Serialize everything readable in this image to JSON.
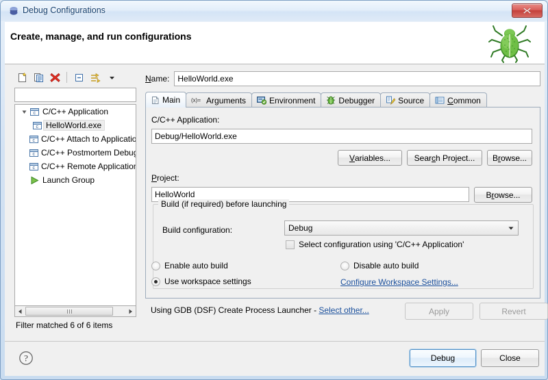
{
  "window": {
    "title": "Debug Configurations",
    "title_icon": "debug-perspective-icon",
    "close_icon": "close-icon"
  },
  "header": {
    "title": "Create, manage, and run configurations",
    "decoration_icon": "green-bug-icon"
  },
  "tree_toolbar": {
    "buttons": [
      {
        "name": "new-launch-configuration-button",
        "icon": "new-document-icon"
      },
      {
        "name": "duplicate-launch-configuration-button",
        "icon": "copy-document-icon"
      },
      {
        "name": "delete-launch-configuration-button",
        "icon": "red-x-delete-icon"
      },
      {
        "name": "collapse-all-button",
        "icon": "collapse-all-icon"
      },
      {
        "name": "filter-launch-configurations-button",
        "icon": "filter-icon"
      },
      {
        "name": "view-menu-button",
        "icon": "chevron-down-icon"
      }
    ]
  },
  "filter": {
    "value": "",
    "placeholder": "",
    "status": "Filter matched 6 of 6 items"
  },
  "tree": {
    "items": [
      {
        "label": "C/C++ Application",
        "icon": "c-application-icon",
        "indent": 0,
        "expanded": true,
        "selected": false
      },
      {
        "label": "HelloWorld.exe",
        "icon": "c-application-icon",
        "indent": 1,
        "expanded": null,
        "selected": true
      },
      {
        "label": "C/C++ Attach to Application",
        "icon": "c-application-icon",
        "indent": 0,
        "expanded": null,
        "selected": false
      },
      {
        "label": "C/C++ Postmortem Debugger",
        "icon": "c-application-icon",
        "indent": 0,
        "expanded": null,
        "selected": false
      },
      {
        "label": "C/C++ Remote Application",
        "icon": "c-application-icon",
        "indent": 0,
        "expanded": null,
        "selected": false
      },
      {
        "label": "Launch Group",
        "icon": "green-play-icon",
        "indent": 0,
        "expanded": null,
        "selected": false
      }
    ]
  },
  "name_field": {
    "label": "Name:",
    "mnemonic": "N",
    "value": "HelloWorld.exe"
  },
  "tabs": [
    {
      "label": "Main",
      "icon": "document-icon",
      "active": true
    },
    {
      "label": "Arguments",
      "icon": "variables-xy-icon",
      "active": false
    },
    {
      "label": "Environment",
      "icon": "environment-icon",
      "active": false
    },
    {
      "label": "Debugger",
      "icon": "bug-gear-icon",
      "active": false
    },
    {
      "label": "Source",
      "icon": "source-lookup-icon",
      "active": false
    },
    {
      "label": "Common",
      "icon": "common-list-icon",
      "active": false
    }
  ],
  "main_tab": {
    "application_label": "C/C++ Application:",
    "application_value": "Debug/HelloWorld.exe",
    "variables_button": "Variables...",
    "search_project_button": "Search Project...",
    "browse_app_button": "Browse...",
    "project_label": "Project:",
    "project_value": "HelloWorld",
    "browse_project_button": "Browse...",
    "build_group_title": "Build (if required) before launching",
    "build_config_label": "Build configuration:",
    "build_config_value": "Debug",
    "build_config_arrow": "chevron-down-icon",
    "select_config_checkbox_label": "Select configuration using 'C/C++ Application'",
    "select_config_checked": false,
    "radio_enable_auto_build": "Enable auto build",
    "radio_disable_auto_build": "Disable auto build",
    "radio_use_workspace_settings": "Use workspace settings",
    "selected_radio": "Use workspace settings",
    "configure_workspace_link": "Configure Workspace Settings..."
  },
  "launcher": {
    "text": "Using GDB (DSF) Create Process Launcher - ",
    "link": "Select other..."
  },
  "action_buttons": {
    "apply": "Apply",
    "apply_enabled": false,
    "revert": "Revert",
    "revert_enabled": false,
    "debug": "Debug",
    "close": "Close",
    "help_icon": "help-question-icon"
  },
  "colors": {
    "title_text": "#16406e",
    "link": "#1a4f9c",
    "close_button": "#c3403c",
    "default_button_border": "#4d8ec6",
    "bug_green": "#57a83a"
  }
}
